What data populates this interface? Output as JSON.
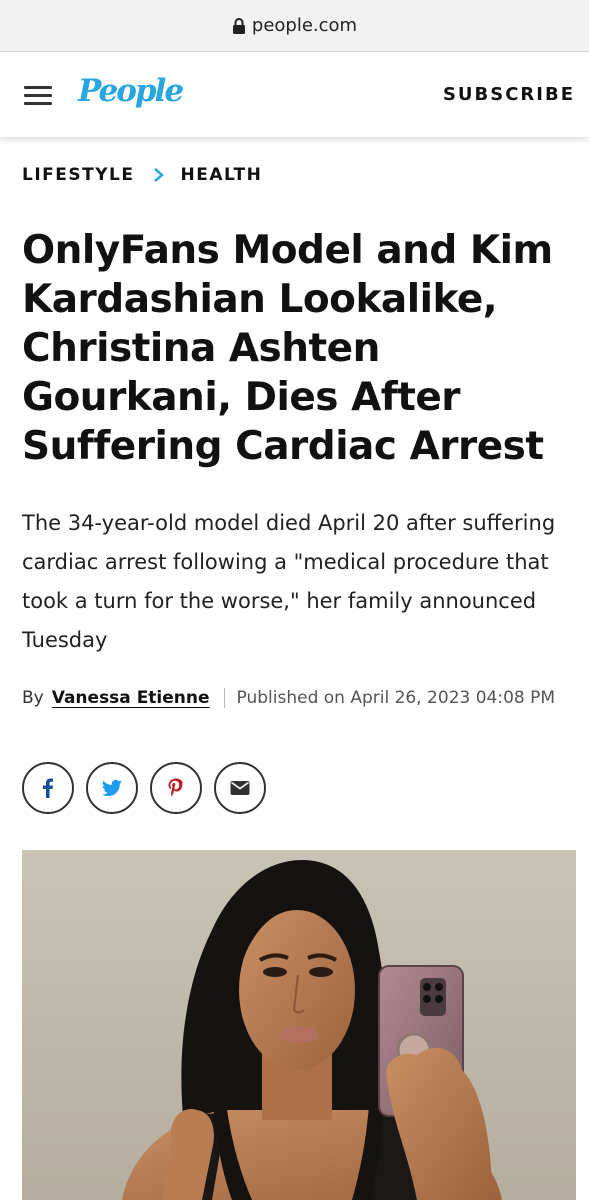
{
  "browser": {
    "url": "people.com"
  },
  "header": {
    "logo": "People",
    "subscribe_label": "SUBSCRIBE"
  },
  "breadcrumb": {
    "items": [
      "LIFESTYLE",
      "HEALTH"
    ]
  },
  "article": {
    "headline": "OnlyFans Model and Kim Kardashian Lookalike, Christina Ashten Gourkani, Dies After Suffering Cardiac Arrest",
    "dek": "The 34-year-old model died April 20 after suffering cardiac arrest following a \"medical procedure that took a turn for the worse,\" her family announced Tuesday",
    "by_label": "By",
    "author": "Vanessa Etienne",
    "published": "Published on April 26, 2023 04:08 PM"
  },
  "share": {
    "buttons": [
      "facebook-icon",
      "twitter-icon",
      "pinterest-icon",
      "email-icon"
    ]
  },
  "colors": {
    "brand": "#28a6df",
    "text": "#111111",
    "urlbar_bg": "#f2f2f3",
    "facebook": "#1a4d97",
    "twitter": "#1d9bf0",
    "pinterest": "#bd1a24"
  }
}
